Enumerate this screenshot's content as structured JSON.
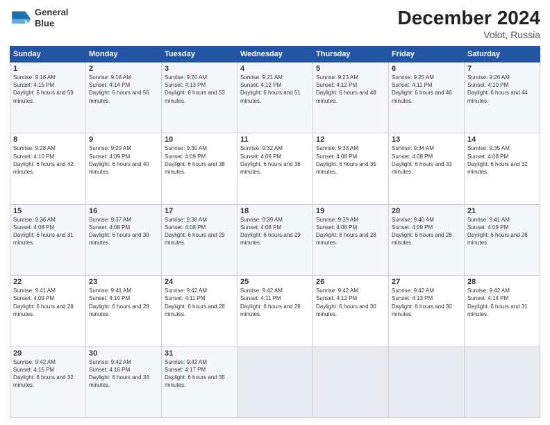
{
  "header": {
    "title": "December 2024",
    "subtitle": "Volot, Russia",
    "logo_line1": "General",
    "logo_line2": "Blue"
  },
  "days_of_week": [
    "Sunday",
    "Monday",
    "Tuesday",
    "Wednesday",
    "Thursday",
    "Friday",
    "Saturday"
  ],
  "weeks": [
    [
      {
        "day": "1",
        "sunrise": "9:16 AM",
        "sunset": "4:15 PM",
        "daylight": "6 hours and 59 minutes."
      },
      {
        "day": "2",
        "sunrise": "9:18 AM",
        "sunset": "4:14 PM",
        "daylight": "6 hours and 56 minutes."
      },
      {
        "day": "3",
        "sunrise": "9:20 AM",
        "sunset": "4:13 PM",
        "daylight": "6 hours and 53 minutes."
      },
      {
        "day": "4",
        "sunrise": "9:21 AM",
        "sunset": "4:12 PM",
        "daylight": "6 hours and 51 minutes."
      },
      {
        "day": "5",
        "sunrise": "9:23 AM",
        "sunset": "4:12 PM",
        "daylight": "6 hours and 48 minutes."
      },
      {
        "day": "6",
        "sunrise": "9:25 AM",
        "sunset": "4:11 PM",
        "daylight": "6 hours and 46 minutes."
      },
      {
        "day": "7",
        "sunrise": "9:26 AM",
        "sunset": "4:10 PM",
        "daylight": "6 hours and 44 minutes."
      }
    ],
    [
      {
        "day": "8",
        "sunrise": "9:28 AM",
        "sunset": "4:10 PM",
        "daylight": "6 hours and 42 minutes."
      },
      {
        "day": "9",
        "sunrise": "9:29 AM",
        "sunset": "4:09 PM",
        "daylight": "6 hours and 40 minutes."
      },
      {
        "day": "10",
        "sunrise": "9:30 AM",
        "sunset": "4:09 PM",
        "daylight": "6 hours and 38 minutes."
      },
      {
        "day": "11",
        "sunrise": "9:32 AM",
        "sunset": "4:08 PM",
        "daylight": "6 hours and 36 minutes."
      },
      {
        "day": "12",
        "sunrise": "9:33 AM",
        "sunset": "4:08 PM",
        "daylight": "6 hours and 35 minutes."
      },
      {
        "day": "13",
        "sunrise": "9:34 AM",
        "sunset": "4:08 PM",
        "daylight": "6 hours and 33 minutes."
      },
      {
        "day": "14",
        "sunrise": "9:35 AM",
        "sunset": "4:08 PM",
        "daylight": "6 hours and 32 minutes."
      }
    ],
    [
      {
        "day": "15",
        "sunrise": "9:36 AM",
        "sunset": "4:08 PM",
        "daylight": "6 hours and 31 minutes."
      },
      {
        "day": "16",
        "sunrise": "9:37 AM",
        "sunset": "4:08 PM",
        "daylight": "6 hours and 30 minutes."
      },
      {
        "day": "17",
        "sunrise": "9:38 AM",
        "sunset": "4:08 PM",
        "daylight": "6 hours and 29 minutes."
      },
      {
        "day": "18",
        "sunrise": "9:39 AM",
        "sunset": "4:08 PM",
        "daylight": "6 hours and 29 minutes."
      },
      {
        "day": "19",
        "sunrise": "9:39 AM",
        "sunset": "4:08 PM",
        "daylight": "6 hours and 28 minutes."
      },
      {
        "day": "20",
        "sunrise": "9:40 AM",
        "sunset": "4:09 PM",
        "daylight": "6 hours and 28 minutes."
      },
      {
        "day": "21",
        "sunrise": "9:41 AM",
        "sunset": "4:09 PM",
        "daylight": "6 hours and 28 minutes."
      }
    ],
    [
      {
        "day": "22",
        "sunrise": "9:41 AM",
        "sunset": "4:09 PM",
        "daylight": "6 hours and 28 minutes."
      },
      {
        "day": "23",
        "sunrise": "9:41 AM",
        "sunset": "4:10 PM",
        "daylight": "6 hours and 28 minutes."
      },
      {
        "day": "24",
        "sunrise": "9:42 AM",
        "sunset": "4:11 PM",
        "daylight": "6 hours and 28 minutes."
      },
      {
        "day": "25",
        "sunrise": "9:42 AM",
        "sunset": "4:11 PM",
        "daylight": "6 hours and 29 minutes."
      },
      {
        "day": "26",
        "sunrise": "9:42 AM",
        "sunset": "4:12 PM",
        "daylight": "6 hours and 30 minutes."
      },
      {
        "day": "27",
        "sunrise": "9:42 AM",
        "sunset": "4:13 PM",
        "daylight": "6 hours and 30 minutes."
      },
      {
        "day": "28",
        "sunrise": "9:42 AM",
        "sunset": "4:14 PM",
        "daylight": "6 hours and 31 minutes."
      }
    ],
    [
      {
        "day": "29",
        "sunrise": "9:42 AM",
        "sunset": "4:15 PM",
        "daylight": "6 hours and 32 minutes."
      },
      {
        "day": "30",
        "sunrise": "9:42 AM",
        "sunset": "4:16 PM",
        "daylight": "6 hours and 34 minutes."
      },
      {
        "day": "31",
        "sunrise": "9:42 AM",
        "sunset": "4:17 PM",
        "daylight": "6 hours and 35 minutes."
      },
      null,
      null,
      null,
      null
    ]
  ]
}
